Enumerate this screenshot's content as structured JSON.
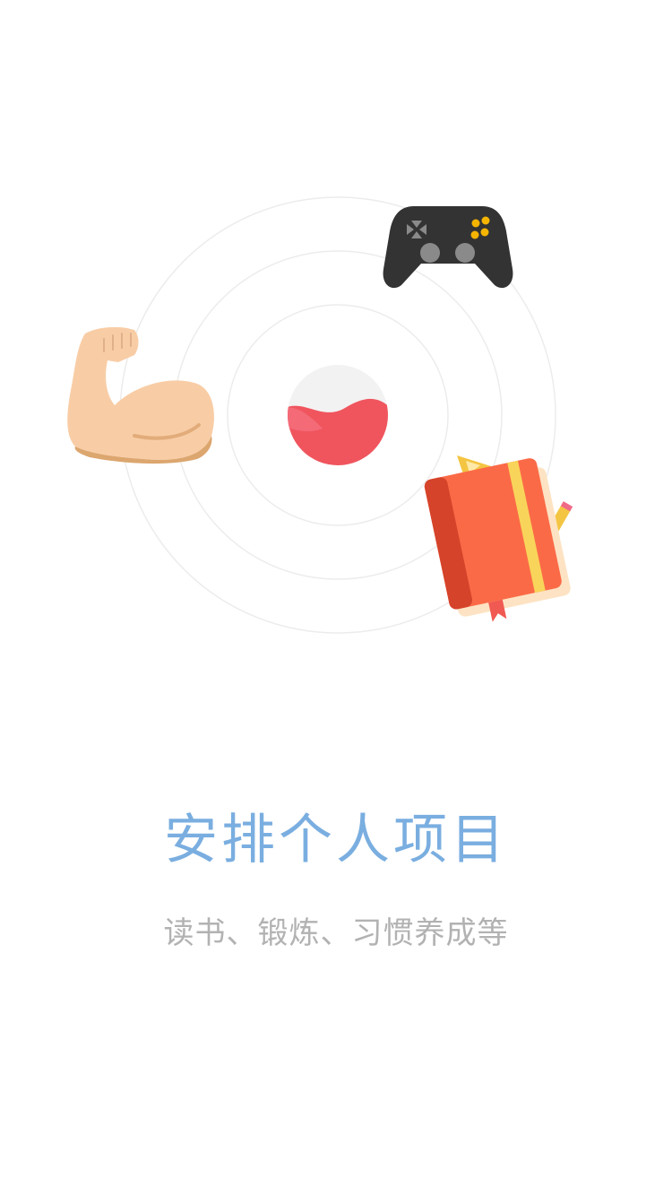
{
  "onboarding": {
    "title": "安排个人项目",
    "subtitle": "读书、锻炼、习惯养成等"
  },
  "illustration": {
    "icons": [
      "app-logo-icon",
      "game-controller-icon",
      "flexed-biceps-icon",
      "notebook-icon"
    ]
  },
  "colors": {
    "title": "#7aaee0",
    "subtitle": "#b2b2b2",
    "accent": "#f0555e",
    "ring": "#ebebeb"
  }
}
